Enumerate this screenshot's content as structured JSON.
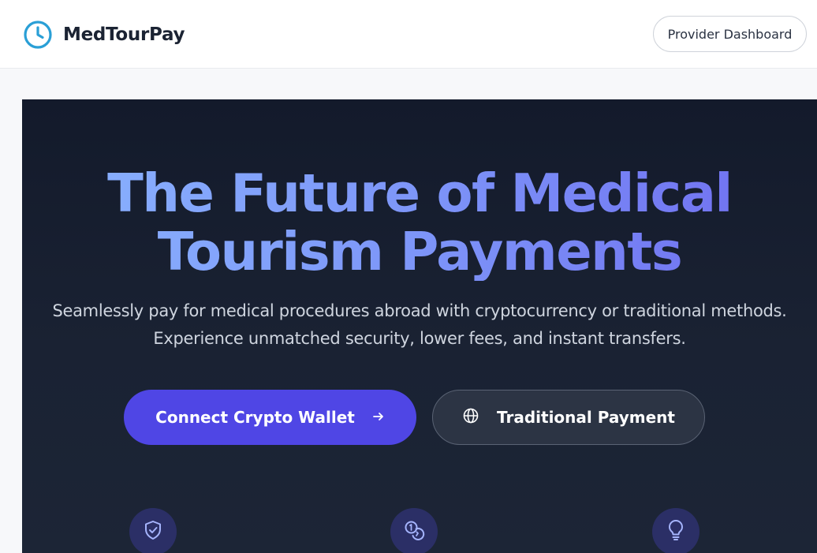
{
  "header": {
    "brand_name": "MedTourPay",
    "brand_icon": "clock-icon",
    "dashboard_label": "Provider Dashboard"
  },
  "hero": {
    "headline_line1": "The Future of Medical",
    "headline_line2": "Tourism Payments",
    "subtext_line1": "Seamlessly pay for medical procedures abroad with cryptocurrency or traditional methods.",
    "subtext_line2": "Experience unmatched security, lower fees, and instant transfers.",
    "primary_button": {
      "label": "Connect Crypto Wallet",
      "icon": "arrow-right-icon"
    },
    "secondary_button": {
      "label": "Traditional Payment",
      "icon": "globe-icon"
    }
  },
  "features": [
    {
      "icon": "shield-check-icon"
    },
    {
      "icon": "coins-icon"
    },
    {
      "icon": "lightbulb-icon"
    }
  ],
  "colors": {
    "brand": "#2a9fd6",
    "primary": "#4f46e5",
    "hero_bg": "#131a2b",
    "feature_icon_bg": "#2b2f66",
    "feature_icon_fg": "#a5b4fc"
  }
}
